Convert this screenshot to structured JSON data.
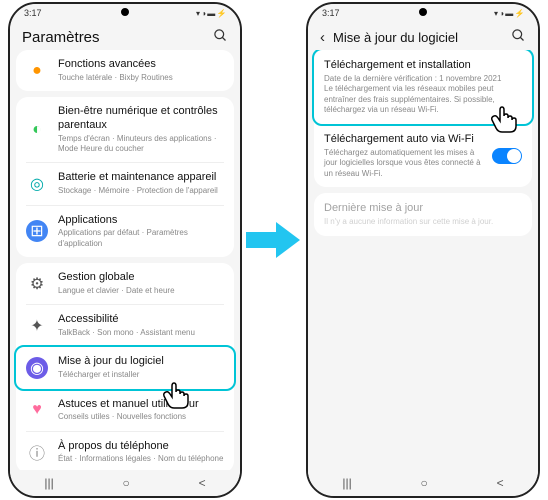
{
  "status": {
    "time": "3:17",
    "icons": "▾ ◑ ▬ ⚡"
  },
  "left": {
    "title": "Paramètres",
    "items": [
      {
        "title": "Fonctions avancées",
        "sub": "Touche latérale · Bixby Routines",
        "icon": "●",
        "cls": "ic-orange"
      },
      {
        "title": "Bien-être numérique et contrôles parentaux",
        "sub": "Temps d'écran · Minuteurs des applications · Mode Heure du coucher",
        "icon": "◐",
        "cls": "ic-green"
      },
      {
        "title": "Batterie et maintenance appareil",
        "sub": "Stockage · Mémoire · Protection de l'appareil",
        "icon": "◎",
        "cls": "ic-teal"
      },
      {
        "title": "Applications",
        "sub": "Applications par défaut · Paramètres d'application",
        "icon": "⊞",
        "cls": "ic-blue"
      },
      {
        "title": "Gestion globale",
        "sub": "Langue et clavier · Date et heure",
        "icon": "⚙",
        "cls": "ic-gray"
      },
      {
        "title": "Accessibilité",
        "sub": "TalkBack · Son mono · Assistant menu",
        "icon": "✦",
        "cls": "ic-gray"
      },
      {
        "title": "Mise à jour du logiciel",
        "sub": "Télécharger et installer",
        "icon": "◉",
        "cls": "ic-purple"
      },
      {
        "title": "Astuces et manuel utilisateur",
        "sub": "Conseils utiles · Nouvelles fonctions",
        "icon": "♥",
        "cls": "ic-pink"
      },
      {
        "title": "À propos du téléphone",
        "sub": "État · Informations légales · Nom du téléphone",
        "icon": "ⓘ",
        "cls": "ic-info"
      }
    ]
  },
  "right": {
    "title": "Mise à jour du logiciel",
    "download": {
      "title": "Téléchargement et installation",
      "sub": "Date de la dernière vérification : 1 novembre 2021\nLe téléchargement via les réseaux mobiles peut entraîner des frais supplémentaires. Si possible, téléchargez via un réseau Wi-Fi."
    },
    "auto": {
      "title": "Téléchargement auto via Wi-Fi",
      "sub": "Téléchargez automatiquement les mises à jour logicielles lorsque vous êtes connecté à un réseau Wi-Fi."
    },
    "last": {
      "title": "Dernière mise à jour",
      "sub": "Il n'y a aucune information sur cette mise à jour."
    }
  },
  "nav": {
    "recent": "|||",
    "home": "○",
    "back": "<"
  }
}
